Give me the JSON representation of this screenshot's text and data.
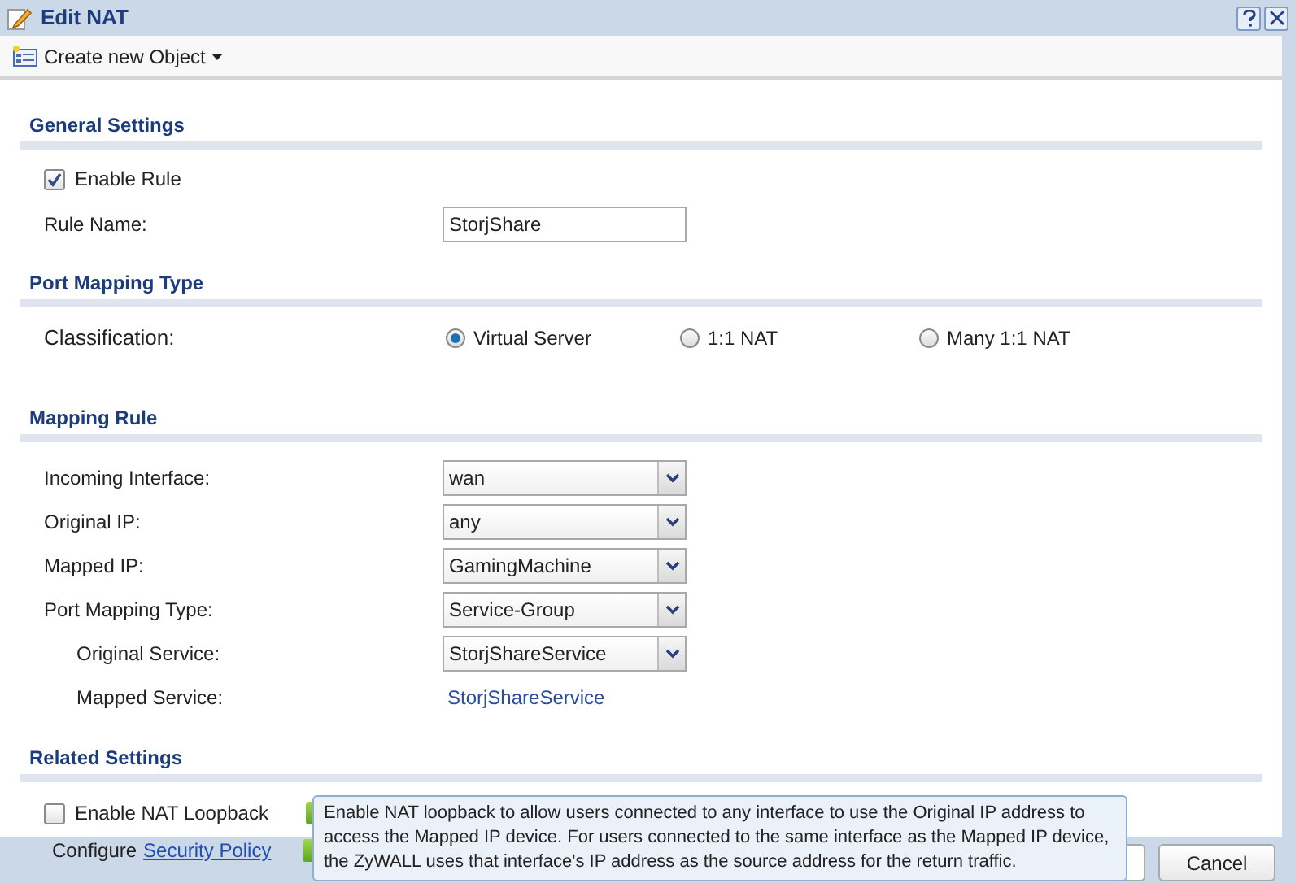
{
  "window": {
    "title": "Edit NAT"
  },
  "toolbar": {
    "create_menu": "Create new Object"
  },
  "general": {
    "title": "General Settings",
    "enable_rule": {
      "label": "Enable Rule",
      "checked": true
    },
    "rule_name": {
      "label": "Rule Name:",
      "value": "StorjShare"
    }
  },
  "port_mapping_type": {
    "title": "Port Mapping Type",
    "label": "Classification:",
    "options": [
      {
        "label": "Virtual Server",
        "selected": true
      },
      {
        "label": "1:1 NAT",
        "selected": false
      },
      {
        "label": "Many 1:1 NAT",
        "selected": false
      }
    ]
  },
  "mapping_rule": {
    "title": "Mapping Rule",
    "rows": [
      {
        "kind": "select",
        "label": "Incoming Interface:",
        "value": "wan"
      },
      {
        "kind": "select",
        "label": "Original IP:",
        "value": "any"
      },
      {
        "kind": "select",
        "label": "Mapped IP:",
        "value": "GamingMachine"
      },
      {
        "kind": "select",
        "label": "Port Mapping Type:",
        "value": "Service-Group"
      },
      {
        "kind": "select",
        "label": "Original Service:",
        "value": "StorjShareService",
        "indented": true
      },
      {
        "kind": "text",
        "label": "Mapped Service:",
        "value": "StorjShareService",
        "indented": true
      }
    ]
  },
  "related": {
    "title": "Related Settings",
    "loopback": {
      "label": "Enable NAT Loopback",
      "checked": false
    },
    "configure": {
      "label": "Configure",
      "link": "Security Policy"
    }
  },
  "tooltip": "Enable NAT loopback to allow users connected to any interface to use the Original IP address to access the Mapped IP device. For users connected to the same interface as the Mapped IP device, the ZyWALL uses that interface's IP address as the source address for the return traffic.",
  "footer": {
    "cancel": "Cancel"
  }
}
